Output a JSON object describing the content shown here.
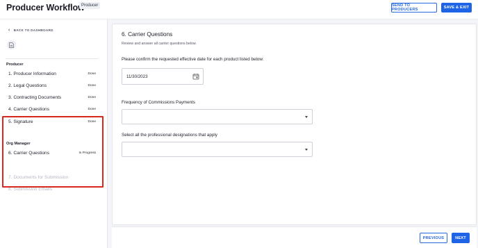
{
  "header": {
    "title": "Producer Workflow",
    "role_badge": "Producer",
    "send_button": "SEND TO PRODUCERS",
    "save_button": "SAVE & EXIT"
  },
  "sidebar": {
    "back_link": "BACK TO DASHBOARD",
    "producer_section": "Producer",
    "producer_steps": [
      {
        "label": "1. Producer Information",
        "status": "Done"
      },
      {
        "label": "2. Legal Questions",
        "status": "Done"
      },
      {
        "label": "3. Contracting Documents",
        "status": "Done"
      },
      {
        "label": "4. Carrier Questions",
        "status": "Done"
      },
      {
        "label": "5. Signature",
        "status": "Done"
      }
    ],
    "org_section": "Org Manager",
    "org_steps": [
      {
        "label": "6. Carrier Questions",
        "status": "In Progress"
      },
      {
        "label": "7. Documents for Submission",
        "status": ""
      },
      {
        "label": "8. Submission Emails",
        "status": ""
      }
    ],
    "highlight_color": "#d7281e"
  },
  "main": {
    "section_title": "6. Carrier Questions",
    "section_subtitle": "Review and answer all carrier questions below.",
    "q1_label": "Please confirm the requested effective date for each product listed below:",
    "q1_value": "11/30/2023",
    "q2_label": "Frequency of Commissions Payments",
    "q2_value": "",
    "q3_label": "Select all the professional designations that apply",
    "q3_value": ""
  },
  "footer": {
    "previous_button": "PREVIOUS",
    "next_button": "NEXT"
  },
  "colors": {
    "accent": "#1f64e6"
  }
}
